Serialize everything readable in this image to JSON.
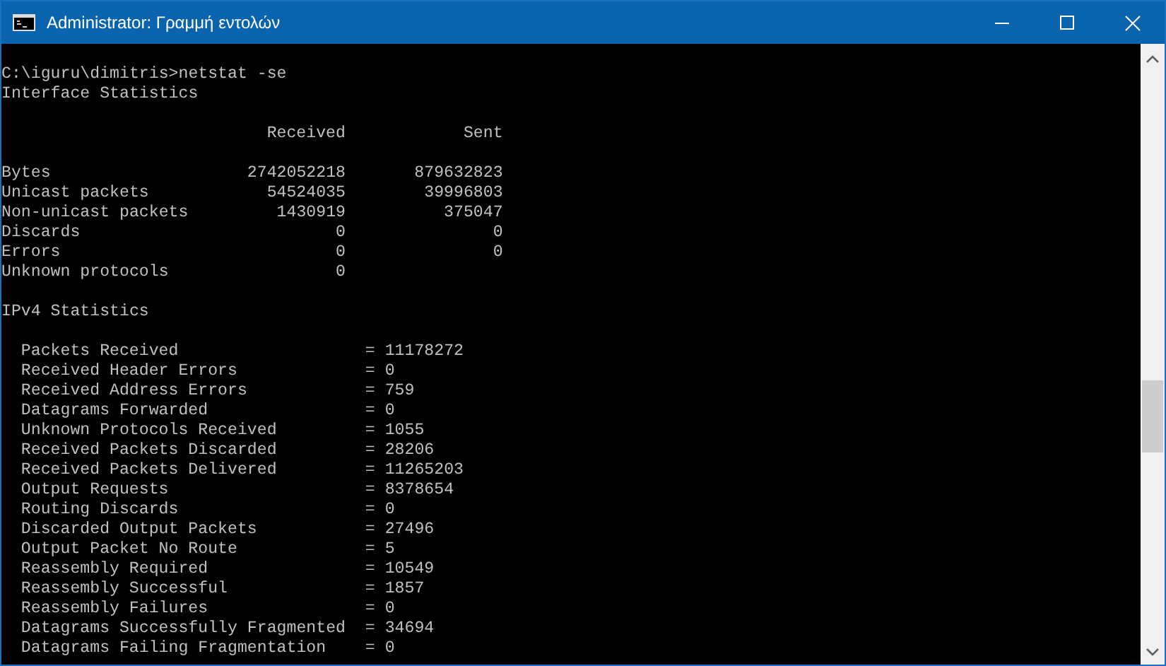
{
  "window": {
    "title": "Administrator: Γραμμή εντολών"
  },
  "console": {
    "command_lines": [
      "C:\\iguru\\dimitris>netstat -se",
      "Interface Statistics"
    ],
    "interface_table": {
      "columns": [
        "Received",
        "Sent"
      ],
      "rows": [
        {
          "label": "Bytes",
          "received": "2742052218",
          "sent": "879632823"
        },
        {
          "label": "Unicast packets",
          "received": "54524035",
          "sent": "39996803"
        },
        {
          "label": "Non-unicast packets",
          "received": "1430919",
          "sent": "375047"
        },
        {
          "label": "Discards",
          "received": "0",
          "sent": "0"
        },
        {
          "label": "Errors",
          "received": "0",
          "sent": "0"
        },
        {
          "label": "Unknown protocols",
          "received": "0"
        }
      ]
    },
    "ipv4_heading": "IPv4 Statistics",
    "ipv4_rows": [
      {
        "label": "Packets Received",
        "value": "= 11178272"
      },
      {
        "label": "Received Header Errors",
        "value": "= 0"
      },
      {
        "label": "Received Address Errors",
        "value": "= 759"
      },
      {
        "label": "Datagrams Forwarded",
        "value": "= 0"
      },
      {
        "label": "Unknown Protocols Received",
        "value": "= 1055"
      },
      {
        "label": "Received Packets Discarded",
        "value": "= 28206"
      },
      {
        "label": "Received Packets Delivered",
        "value": "= 11265203"
      },
      {
        "label": "Output Requests",
        "value": "= 8378654"
      },
      {
        "label": "Routing Discards",
        "value": "= 0"
      },
      {
        "label": "Discarded Output Packets",
        "value": "= 27496"
      },
      {
        "label": "Output Packet No Route",
        "value": "= 5"
      },
      {
        "label": "Reassembly Required",
        "value": "= 10549"
      },
      {
        "label": "Reassembly Successful",
        "value": "= 1857"
      },
      {
        "label": "Reassembly Failures",
        "value": "= 0"
      },
      {
        "label": "Datagrams Successfully Fragmented",
        "value": "= 34694"
      },
      {
        "label": "Datagrams Failing Fragmentation",
        "value": "= 0"
      }
    ]
  }
}
